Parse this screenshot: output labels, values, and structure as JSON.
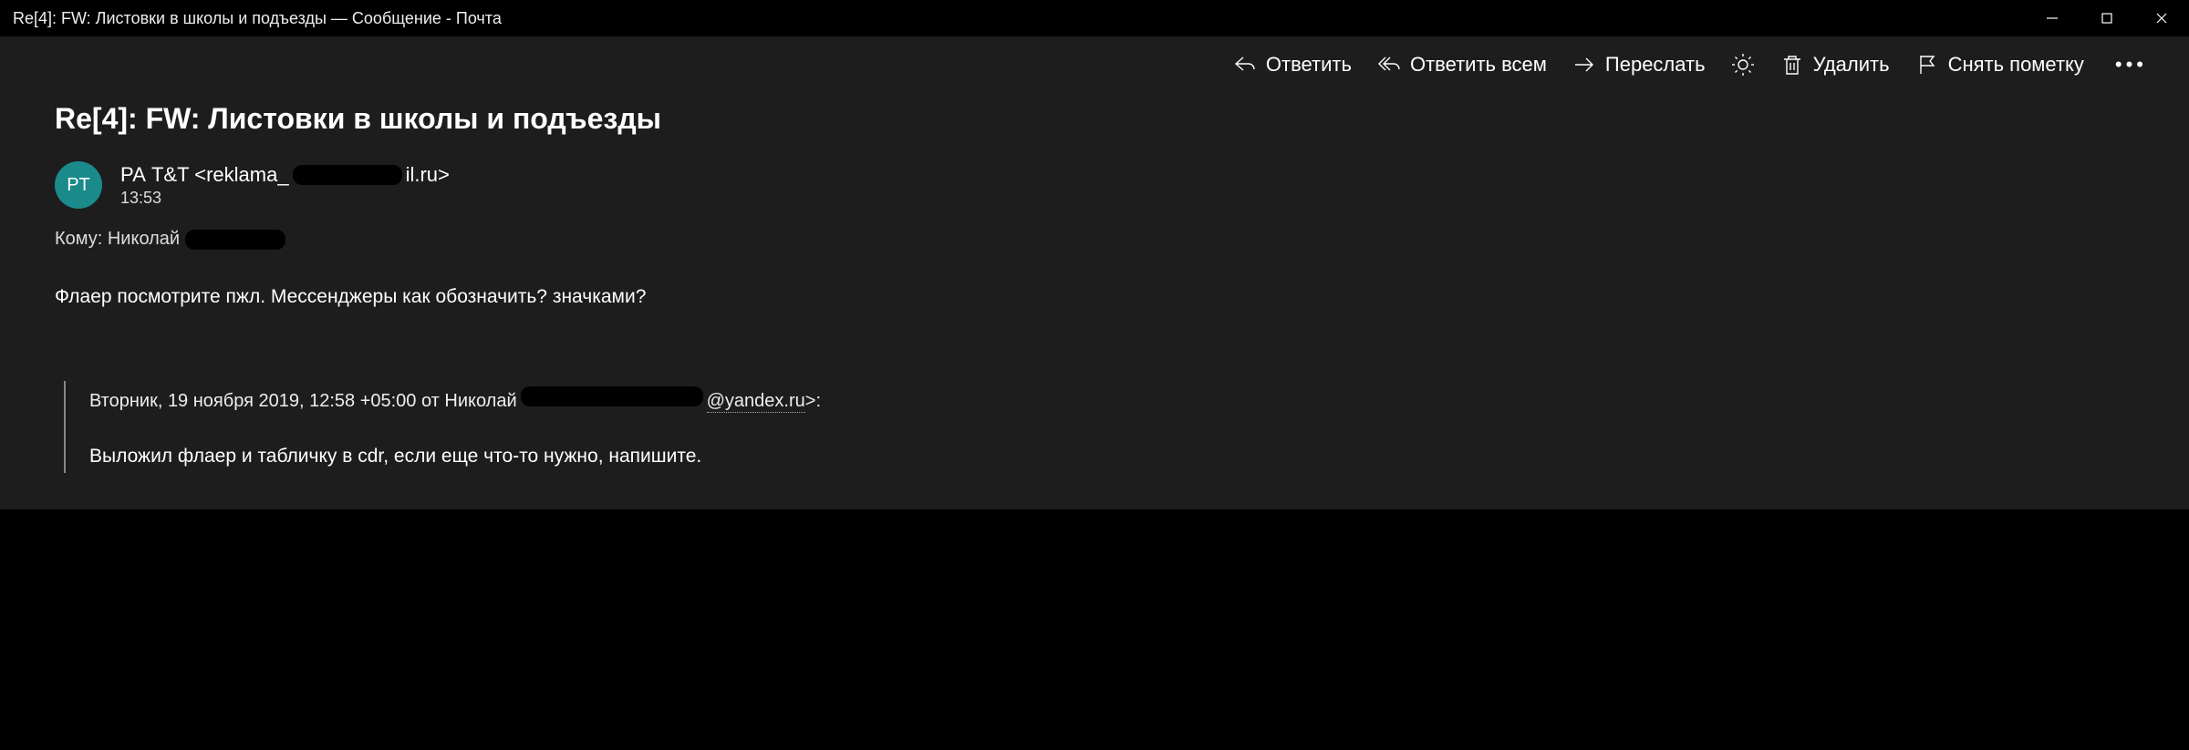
{
  "window": {
    "title": "Re[4]: FW: Листовки в школы и подъезды — Сообщение - Почта"
  },
  "toolbar": {
    "reply": "Ответить",
    "reply_all": "Ответить всем",
    "forward": "Переслать",
    "delete": "Удалить",
    "unflag": "Снять пометку"
  },
  "message": {
    "subject": "Re[4]: FW: Листовки в школы и подъезды",
    "avatar_initials": "PT",
    "sender_prefix": "РА T&T <reklama_",
    "sender_suffix": "il.ru>",
    "time": "13:53",
    "to_label": "Кому: Николай ",
    "body": "Флаер посмотрите пжл. Мессенджеры как обозначить? значками?"
  },
  "quote": {
    "header_prefix": "Вторник, 19 ноября 2019, 12:58 +05:00 от Николай ",
    "header_email": "@yandex.ru",
    "header_suffix": ">:",
    "body": "Выложил флаер и табличку в cdr, если еще что-то нужно, напишите."
  }
}
